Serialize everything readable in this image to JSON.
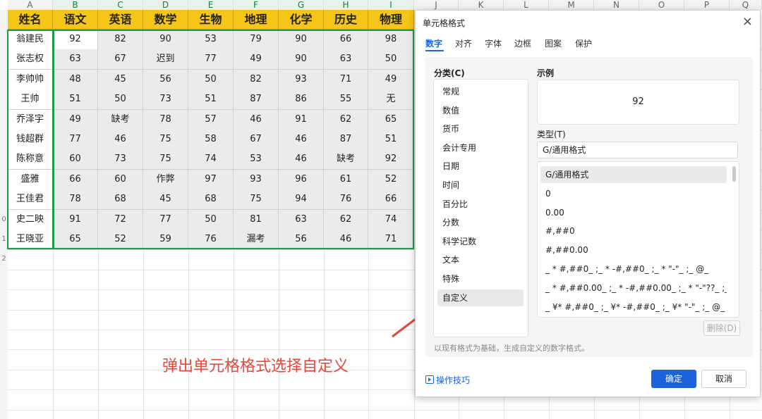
{
  "sheet": {
    "col_letters": [
      "A",
      "B",
      "C",
      "D",
      "E",
      "F",
      "G",
      "H",
      "I",
      "J",
      "K",
      "L",
      "M",
      "N",
      "O",
      "P",
      "Q"
    ],
    "row_numbers": [
      "0",
      "1",
      "2"
    ],
    "headers": [
      "姓名",
      "语文",
      "英语",
      "数学",
      "生物",
      "地理",
      "化学",
      "历史",
      "物理"
    ],
    "rows": [
      [
        "翁建民",
        "92",
        "82",
        "90",
        "53",
        "79",
        "90",
        "66",
        "98"
      ],
      [
        "张志权",
        "63",
        "67",
        "迟到",
        "77",
        "49",
        "90",
        "63",
        "50"
      ],
      [
        "李帅帅",
        "48",
        "45",
        "56",
        "50",
        "82",
        "93",
        "71",
        "49"
      ],
      [
        "王帅",
        "51",
        "50",
        "73",
        "51",
        "87",
        "86",
        "55",
        "无"
      ],
      [
        "乔泽宇",
        "49",
        "缺考",
        "78",
        "57",
        "46",
        "91",
        "62",
        "65"
      ],
      [
        "钱超群",
        "77",
        "46",
        "75",
        "58",
        "67",
        "46",
        "87",
        "51"
      ],
      [
        "陈称意",
        "60",
        "73",
        "75",
        "74",
        "53",
        "46",
        "缺考",
        "92"
      ],
      [
        "盛雅",
        "66",
        "60",
        "作弊",
        "97",
        "93",
        "96",
        "61",
        "52"
      ],
      [
        "王佳君",
        "78",
        "68",
        "45",
        "68",
        "75",
        "94",
        "76",
        "66"
      ],
      [
        "史二映",
        "91",
        "72",
        "77",
        "50",
        "81",
        "63",
        "62",
        "74"
      ],
      [
        "王晓亚",
        "65",
        "52",
        "59",
        "76",
        "漏考",
        "56",
        "46",
        "71"
      ]
    ]
  },
  "annotation": "弹出单元格格式选择自定义",
  "colors": {
    "accent": "#1b63d9",
    "header_fill": "#f5c518",
    "selection": "#1f9a4b",
    "annotation": "#e5483c"
  },
  "dialog": {
    "title": "单元格格式",
    "close_icon": "×",
    "tabs": [
      "数字",
      "对齐",
      "字体",
      "边框",
      "图案",
      "保护"
    ],
    "category_label": "分类(C)",
    "categories": [
      "常规",
      "数值",
      "货币",
      "会计专用",
      "日期",
      "时间",
      "百分比",
      "分数",
      "科学记数",
      "文本",
      "特殊",
      "自定义"
    ],
    "selected_category": "自定义",
    "sample_label": "示例",
    "sample_value": "92",
    "type_label": "类型(T)",
    "type_value": "G/通用格式",
    "formats": [
      "G/通用格式",
      "0",
      "0.00",
      "#,##0",
      "#,##0.00",
      "_ * #,##0_ ;_ * -#,##0_ ;_ * \"-\"_ ;_ @_",
      "_ * #,##0.00_ ;_ * -#,##0.00_ ;_ * \"-\"??_ ;_ @_",
      "_ ¥* #,##0_ ;_ ¥* -#,##0_ ;_ ¥* \"-\"_ ;_ @_"
    ],
    "delete_label": "删除(D)",
    "hint": "以现有格式为基础，生成自定义的数字格式。",
    "tips_label": "操作技巧",
    "ok_label": "确定",
    "cancel_label": "取消"
  }
}
